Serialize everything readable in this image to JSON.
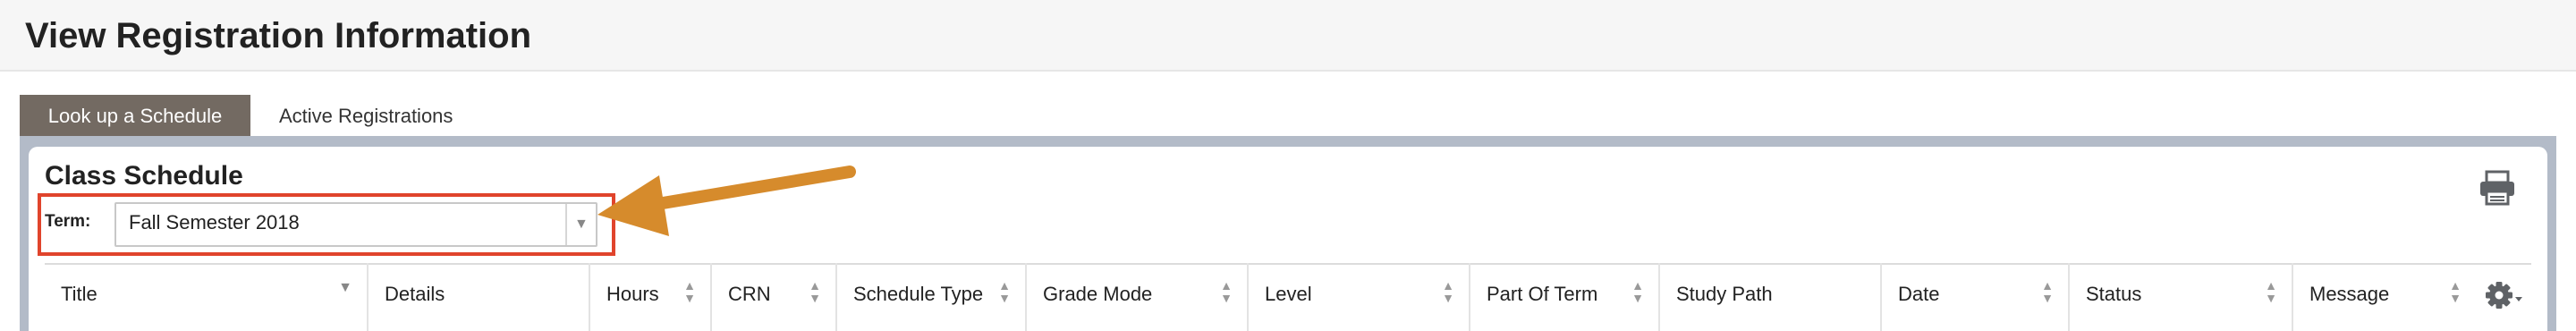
{
  "page": {
    "title": "View Registration Information"
  },
  "tabs": [
    {
      "label": "Look up a Schedule",
      "active": true
    },
    {
      "label": "Active Registrations",
      "active": false
    }
  ],
  "schedule": {
    "title": "Class Schedule",
    "term_label": "Term:",
    "term_value": "Fall Semester 2018"
  },
  "table": {
    "columns": [
      {
        "label": "Title",
        "sort": "dropdown"
      },
      {
        "label": "Details",
        "sort": "none"
      },
      {
        "label": "Hours",
        "sort": "both"
      },
      {
        "label": "CRN",
        "sort": "both"
      },
      {
        "label": "Schedule Type",
        "sort": "both"
      },
      {
        "label": "Grade Mode",
        "sort": "both"
      },
      {
        "label": "Level",
        "sort": "both"
      },
      {
        "label": "Part Of Term",
        "sort": "both"
      },
      {
        "label": "Study Path",
        "sort": "none"
      },
      {
        "label": "Date",
        "sort": "both"
      },
      {
        "label": "Status",
        "sort": "both"
      },
      {
        "label": "Message",
        "sort": "both"
      }
    ]
  },
  "colors": {
    "active_tab": "#736a62",
    "panel_frame": "#b3bbc8",
    "highlight_box": "#e0442c",
    "arrow": "#d68b2c"
  },
  "icons": [
    "print-icon",
    "gear-icon",
    "chevron-down-icon",
    "sort-icon"
  ]
}
